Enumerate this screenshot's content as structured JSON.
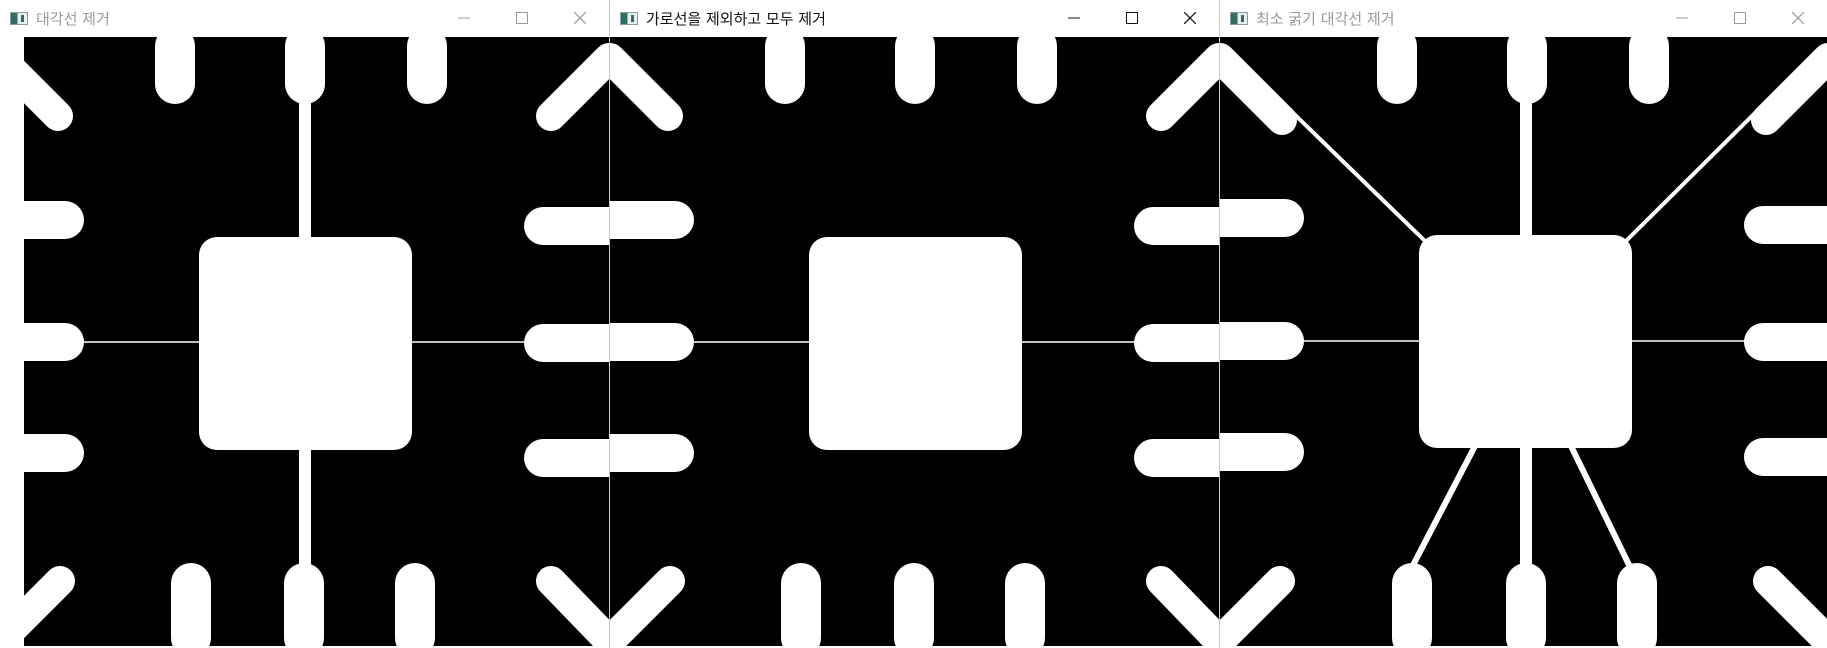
{
  "windows": [
    {
      "title": "대각선 제거",
      "state": "inactive",
      "controls": [
        "minimize-icon",
        "maximize-icon",
        "close-icon"
      ]
    },
    {
      "title": "가로선을 제외하고 모두 제거",
      "state": "active",
      "controls": [
        "minimize-icon",
        "maximize-icon",
        "close-icon"
      ]
    },
    {
      "title": "최소 굵기 대각선 제거",
      "state": "inactive",
      "controls": [
        "minimize-icon",
        "maximize-icon",
        "close-icon"
      ]
    }
  ],
  "colors": {
    "image_background": "#000000",
    "image_foreground": "#ffffff",
    "inactive_title": "#9a9a9a",
    "active_title": "#111111"
  }
}
